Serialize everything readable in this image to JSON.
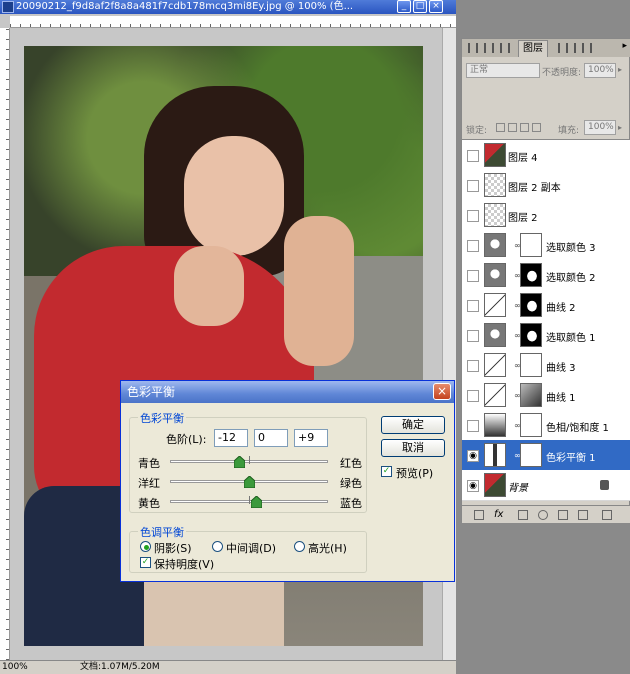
{
  "document": {
    "title": "20090212_f9d8af2f8a8a481f7cdb178mcq3mi8Ey.jpg @ 100% (色...",
    "status_zoom": "100%",
    "status_doc": "文档:1.07M/5.20M",
    "win_buttons": [
      "_",
      "□",
      "×"
    ]
  },
  "dialog": {
    "title": "色彩平衡",
    "close_glyph": "×",
    "color_balance_group": "色彩平衡",
    "levels_label": "色阶(L):",
    "levels": [
      "-12",
      "0",
      "+9"
    ],
    "sliders": [
      {
        "left": "青色",
        "right": "红色",
        "value": -12
      },
      {
        "left": "洋红",
        "right": "绿色",
        "value": 0
      },
      {
        "left": "黄色",
        "right": "蓝色",
        "value": 9
      }
    ],
    "ok_label": "确定",
    "cancel_label": "取消",
    "preview_label": "预览(P)",
    "preview_checked": true,
    "tone_group": "色调平衡",
    "tones": [
      {
        "label": "阴影(S)",
        "selected": true
      },
      {
        "label": "中间调(D)",
        "selected": false
      },
      {
        "label": "高光(H)",
        "selected": false
      }
    ],
    "preserve_label": "保持明度(V)",
    "preserve_checked": true
  },
  "layers_panel": {
    "tab_label": "图层",
    "blend_mode": "正常",
    "opacity_label": "不透明度:",
    "opacity_value": "100%",
    "lock_label": "锁定:",
    "fill_label": "填充:",
    "fill_value": "100%",
    "layers": [
      {
        "name": "图层 4",
        "thumb": "photo",
        "mask": null,
        "visible": false,
        "selected": false
      },
      {
        "name": "图层 2 副本",
        "thumb": "transparent",
        "mask": null,
        "visible": false,
        "selected": false
      },
      {
        "name": "图层 2",
        "thumb": "transparent",
        "mask": null,
        "visible": false,
        "selected": false
      },
      {
        "name": "选取颜色 3",
        "thumb": "selective-color",
        "mask": "white",
        "visible": false,
        "selected": false
      },
      {
        "name": "选取颜色 2",
        "thumb": "selective-color",
        "mask": "silhouette",
        "visible": false,
        "selected": false
      },
      {
        "name": "曲线 2",
        "thumb": "curves",
        "mask": "silhouette",
        "visible": false,
        "selected": false
      },
      {
        "name": "选取颜色 1",
        "thumb": "selective-color",
        "mask": "silhouette",
        "visible": false,
        "selected": false
      },
      {
        "name": "曲线 3",
        "thumb": "curves",
        "mask": "white",
        "visible": false,
        "selected": false
      },
      {
        "name": "曲线 1",
        "thumb": "curves",
        "mask": "gray-photo",
        "visible": false,
        "selected": false
      },
      {
        "name": "色相/饱和度 1",
        "thumb": "hue-sat",
        "mask": "white",
        "visible": false,
        "selected": false
      },
      {
        "name": "色彩平衡 1",
        "thumb": "color-balance",
        "mask": "white",
        "visible": true,
        "selected": true
      },
      {
        "name": "背景",
        "thumb": "photo",
        "mask": null,
        "visible": true,
        "selected": false,
        "locked": true
      }
    ],
    "icons": [
      "eye-icon",
      "link-icon",
      "lock-icon",
      "fx-icon",
      "mask-icon",
      "adjustment-icon",
      "folder-icon",
      "new-layer-icon",
      "trash-icon"
    ]
  },
  "colors": {
    "selection": "#316ac5",
    "dialog_bg": "#ece9d8",
    "group_title": "#0046d5",
    "titlebar": "#2a55c0"
  }
}
